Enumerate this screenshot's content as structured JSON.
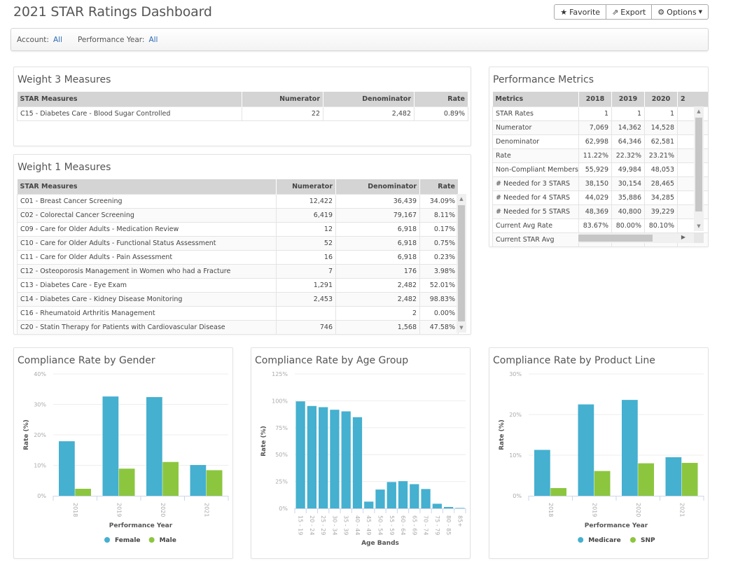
{
  "header": {
    "title": "2021 STAR Ratings Dashboard",
    "buttons": [
      {
        "icon": "star-icon",
        "label": "Favorite"
      },
      {
        "icon": "export-icon",
        "label": "Export"
      },
      {
        "icon": "gear-icon",
        "label": "Options"
      }
    ]
  },
  "filters": {
    "account_label": "Account:",
    "account_value": "All",
    "year_label": "Performance Year:",
    "year_value": "All"
  },
  "weight3": {
    "title": "Weight 3 Measures",
    "columns": [
      "STAR Measures",
      "Numerator",
      "Denominator",
      "Rate"
    ],
    "rows": [
      [
        "C15 - Diabetes Care - Blood Sugar Controlled",
        "22",
        "2,482",
        "0.89%"
      ]
    ]
  },
  "weight1": {
    "title": "Weight 1 Measures",
    "columns": [
      "STAR Measures",
      "Numerator",
      "Denominator",
      "Rate"
    ],
    "rows": [
      [
        "C01 - Breast Cancer Screening",
        "12,422",
        "36,439",
        "34.09%"
      ],
      [
        "C02 - Colorectal Cancer Screening",
        "6,419",
        "79,167",
        "8.11%"
      ],
      [
        "C09 - Care for Older Adults - Medication Review",
        "12",
        "6,918",
        "0.17%"
      ],
      [
        "C10 - Care for Older Adults - Functional Status Assessment",
        "52",
        "6,918",
        "0.75%"
      ],
      [
        "C11 - Care for Older Adults - Pain Assessment",
        "16",
        "6,918",
        "0.23%"
      ],
      [
        "C12 - Osteoporosis Management in Women who had a Fracture",
        "7",
        "176",
        "3.98%"
      ],
      [
        "C13 - Diabetes Care - Eye Exam",
        "1,291",
        "2,482",
        "52.01%"
      ],
      [
        "C14 - Diabetes Care - Kidney Disease Monitoring",
        "2,453",
        "2,482",
        "98.83%"
      ],
      [
        "C16 - Rheumatoid Arthritis Management",
        "",
        "2",
        "0.00%"
      ],
      [
        "C20 - Statin Therapy for Patients with Cardiovascular Disease",
        "746",
        "1,568",
        "47.58%"
      ]
    ]
  },
  "metrics": {
    "title": "Performance Metrics",
    "columns": [
      "Metrics",
      "2018",
      "2019",
      "2020",
      "2"
    ],
    "rows": [
      [
        "STAR Rates",
        "1",
        "1",
        "1"
      ],
      [
        "Numerator",
        "7,069",
        "14,362",
        "14,528"
      ],
      [
        "Denominator",
        "62,998",
        "64,346",
        "62,581"
      ],
      [
        "Rate",
        "11.22%",
        "22.32%",
        "23.21%"
      ],
      [
        "Non-Compliant Members",
        "55,929",
        "49,984",
        "48,053"
      ],
      [
        "# Needed for 3 STARS",
        "38,150",
        "30,154",
        "28,465"
      ],
      [
        "# Needed for 4 STARS",
        "44,029",
        "35,886",
        "34,285"
      ],
      [
        "# Needed for 5 STARS",
        "48,369",
        "40,800",
        "39,229"
      ],
      [
        "Current Avg Rate",
        "83.67%",
        "80.00%",
        "80.10%"
      ],
      [
        "Current STAR Avg",
        "",
        "",
        ""
      ]
    ]
  },
  "colors": {
    "primary": "#45b0cf",
    "secondary": "#8cc63f",
    "grid": "#eeeeee",
    "link": "#2a6bb5"
  },
  "chart_data": [
    {
      "type": "bar",
      "title": "Compliance Rate by Gender",
      "xlabel": "Performance Year",
      "ylabel": "Rate (%)",
      "categories": [
        "2018",
        "2019",
        "2020",
        "2021"
      ],
      "series": [
        {
          "name": "Female",
          "values": [
            17.9,
            32.6,
            32.4,
            10.1
          ]
        },
        {
          "name": "Male",
          "values": [
            2.3,
            8.9,
            11.1,
            8.4
          ]
        }
      ],
      "ylim": [
        0,
        40
      ],
      "yticks": [
        "0%",
        "10%",
        "20%",
        "30%",
        "40%"
      ],
      "grid": true,
      "legend": "bottom"
    },
    {
      "type": "bar",
      "title": "Compliance Rate by Age Group",
      "xlabel": "Age Bands",
      "ylabel": "Rate (%)",
      "categories": [
        "15 - 19",
        "20 - 24",
        "25 - 29",
        "30 - 34",
        "35 - 39",
        "40 - 44",
        "45 - 49",
        "50 - 54",
        "55 - 59",
        "60 - 64",
        "65 - 69",
        "70 - 74",
        "75 - 79",
        "80 - 85",
        "85+"
      ],
      "series": [
        {
          "name": "Rate",
          "values": [
            99.5,
            95.2,
            94.1,
            91.7,
            90.2,
            84.8,
            6.3,
            17.5,
            24.5,
            25.3,
            22.5,
            18.0,
            4.3,
            1.3,
            0.4
          ]
        }
      ],
      "ylim": [
        0,
        125
      ],
      "yticks": [
        "0%",
        "25%",
        "50%",
        "75%",
        "100%",
        "125%"
      ],
      "grid": true,
      "legend": "none"
    },
    {
      "type": "bar",
      "title": "Compliance Rate by Product Line",
      "xlabel": "Performance Year",
      "ylabel": "Rate (%)",
      "categories": [
        "2018",
        "2019",
        "2020",
        "2021"
      ],
      "series": [
        {
          "name": "Medicare",
          "values": [
            11.3,
            22.5,
            23.6,
            9.5
          ]
        },
        {
          "name": "SNP",
          "values": [
            1.9,
            6.1,
            8.0,
            8.1
          ]
        }
      ],
      "ylim": [
        0,
        30
      ],
      "yticks": [
        "0%",
        "10%",
        "20%",
        "30%"
      ],
      "grid": true,
      "legend": "bottom"
    }
  ]
}
